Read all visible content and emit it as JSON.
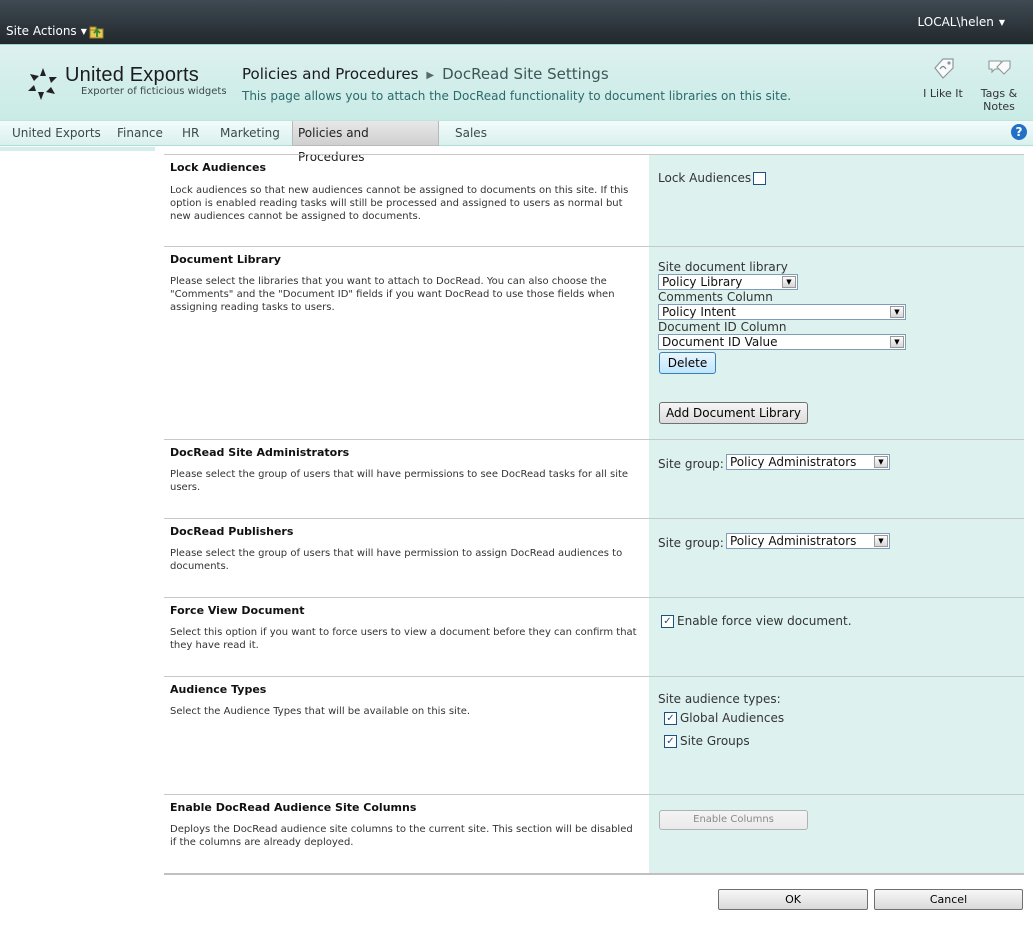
{
  "topbar": {
    "site_actions": "Site Actions",
    "user": "LOCAL\\helen"
  },
  "brand": {
    "title": "United Exports",
    "subtitle": "Exporter of ficticious widgets"
  },
  "header": {
    "breadcrumb_parent": "Policies and Procedures",
    "breadcrumb_current": "DocRead Site Settings",
    "description": "This page allows you to attach the DocRead functionality to document libraries on this site."
  },
  "social": {
    "like_label": "I Like It",
    "tags_label_line1": "Tags &",
    "tags_label_line2": "Notes"
  },
  "nav": {
    "items": [
      "United Exports",
      "Finance",
      "HR",
      "Marketing",
      "Policies and Procedures",
      "Sales"
    ],
    "selected": "Policies and Procedures",
    "help": "?"
  },
  "sections": {
    "lock": {
      "title": "Lock Audiences",
      "desc": "Lock audiences so that new audiences cannot be assigned to documents on this site. If this option is enabled reading tasks will still be processed and assigned to users as normal but new audiences cannot be assigned to documents.",
      "checkbox_label": "Lock Audiences",
      "checked": false
    },
    "doclib": {
      "title": "Document Library",
      "desc": "Please select the libraries that you want to attach to DocRead. You can also choose the \"Comments\" and the \"Document ID\" fields if you want DocRead to use those fields when assigning reading tasks to users.",
      "site_lib_label": "Site document library",
      "site_lib_value": "Policy Library",
      "comments_label": "Comments Column",
      "comments_value": "Policy Intent",
      "docid_label": "Document ID Column",
      "docid_value": "Document ID Value",
      "delete_button": "Delete",
      "add_button": "Add Document Library"
    },
    "admins": {
      "title": "DocRead Site Administrators",
      "desc": "Please select the group of users that will have permissions to see DocRead tasks for all site users.",
      "group_label": "Site group:",
      "group_value": "Policy Administrators"
    },
    "publishers": {
      "title": "DocRead Publishers",
      "desc": "Please select the group of users that will have permission to assign DocRead audiences to documents.",
      "group_label": "Site group:",
      "group_value": "Policy Administrators"
    },
    "forceview": {
      "title": "Force View Document",
      "desc": "Select this option if you want to force users to view a document before they can confirm that they have read it.",
      "checkbox_label": "Enable force view document.",
      "checked": true
    },
    "audtypes": {
      "title": "Audience Types",
      "desc": "Select the Audience Types that will be available on this site.",
      "label": "Site audience types:",
      "options": [
        {
          "label": "Global Audiences",
          "checked": true
        },
        {
          "label": "Site Groups",
          "checked": true
        }
      ]
    },
    "columns": {
      "title": "Enable DocRead Audience Site Columns",
      "desc": "Deploys the DocRead audience site columns to the current site. This section will be disabled if the columns are already deployed.",
      "button": "Enable Columns"
    }
  },
  "footer": {
    "ok": "OK",
    "cancel": "Cancel"
  },
  "check_glyph": "✓",
  "dropdown_glyph": "▼"
}
